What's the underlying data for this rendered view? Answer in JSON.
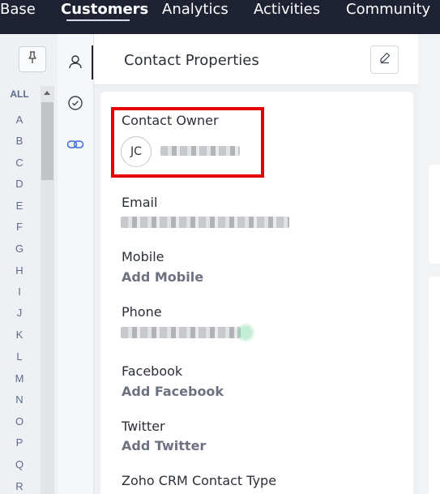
{
  "nav": {
    "items": [
      "Base",
      "Customers",
      "Analytics",
      "Activities",
      "Community"
    ],
    "active": "Customers"
  },
  "alphabet": [
    "ALL",
    "A",
    "B",
    "C",
    "D",
    "E",
    "F",
    "G",
    "H",
    "I",
    "J",
    "K",
    "L",
    "M",
    "N",
    "O",
    "P",
    "Q",
    "R"
  ],
  "panel": {
    "title": "Contact Properties"
  },
  "properties": {
    "owner_label": "Contact Owner",
    "owner_initials": "JC",
    "email_label": "Email",
    "mobile_label": "Mobile",
    "mobile_action": "Add Mobile",
    "phone_label": "Phone",
    "facebook_label": "Facebook",
    "facebook_action": "Add Facebook",
    "twitter_label": "Twitter",
    "twitter_action": "Add Twitter",
    "crm_type_label": "Zoho CRM Contact Type"
  },
  "icons": {
    "pin": "pin-icon",
    "edit": "edit-icon",
    "contact": "user-icon",
    "check": "check-circle-icon",
    "link": "link-icon"
  },
  "colors": {
    "nav_bg": "#1f2233",
    "highlight": "#e30000",
    "accent": "#3a6fd8"
  }
}
